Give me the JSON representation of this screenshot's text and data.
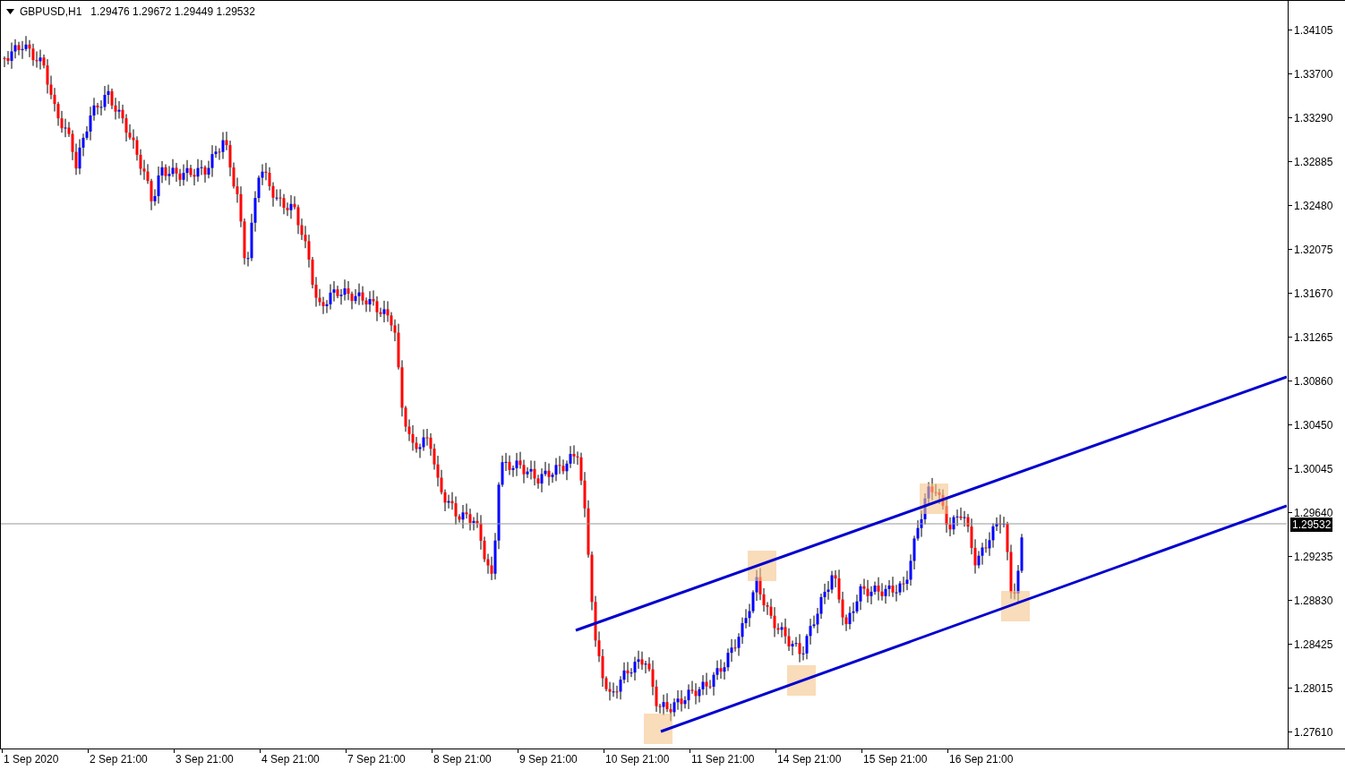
{
  "header": {
    "symbol": "GBPUSD,H1",
    "quotes": "1.29476 1.29672 1.29449 1.29532"
  },
  "price_axis": {
    "labels": [
      "1.34105",
      "1.33700",
      "1.33290",
      "1.32885",
      "1.32480",
      "1.32075",
      "1.31670",
      "1.31265",
      "1.30860",
      "1.30450",
      "1.30045",
      "1.29640",
      "1.29235",
      "1.28830",
      "1.28425",
      "1.28015",
      "1.27610"
    ],
    "current_price": "1.29532"
  },
  "time_axis": {
    "labels": [
      "1 Sep 2020",
      "2 Sep 21:00",
      "3 Sep 21:00",
      "4 Sep 21:00",
      "7 Sep 21:00",
      "8 Sep 21:00",
      "9 Sep 21:00",
      "10 Sep 21:00",
      "11 Sep 21:00",
      "14 Sep 21:00",
      "15 Sep 21:00",
      "16 Sep 21:00"
    ]
  }
}
